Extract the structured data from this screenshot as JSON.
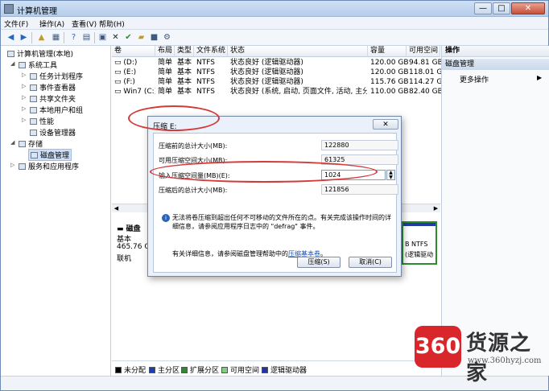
{
  "window": {
    "title": "计算机管理",
    "controls": {
      "minimize": "—",
      "maximize": "□",
      "close": "✕"
    }
  },
  "menu": [
    "文件(F)",
    "操作(A)",
    "查看(V)",
    "帮助(H)"
  ],
  "toolbar_icons": [
    "back-icon",
    "forward-icon",
    "up-icon",
    "console-icon",
    "help-icon",
    "view-icon",
    "properties-icon",
    "delete-icon",
    "check-icon",
    "open-icon",
    "save-icon",
    "settings-icon"
  ],
  "tree": {
    "root": "计算机管理(本地)",
    "system_tools": "系统工具",
    "task_scheduler": "任务计划程序",
    "event_viewer": "事件查看器",
    "shared_folders": "共享文件夹",
    "local_users": "本地用户和组",
    "performance": "性能",
    "device_manager": "设备管理器",
    "storage": "存储",
    "disk_management": "磁盘管理",
    "services": "服务和应用程序"
  },
  "volume_table": {
    "headers": [
      "卷",
      "布局",
      "类型",
      "文件系统",
      "状态",
      "容量",
      "可用空间"
    ],
    "rows": [
      [
        "(D:)",
        "简单",
        "基本",
        "NTFS",
        "状态良好 (逻辑驱动器)",
        "120.00 GB",
        "94.81 GB"
      ],
      [
        "(E:)",
        "简单",
        "基本",
        "NTFS",
        "状态良好 (逻辑驱动器)",
        "120.00 GB",
        "118.01 GB"
      ],
      [
        "(F:)",
        "简单",
        "基本",
        "NTFS",
        "状态良好 (逻辑驱动器)",
        "115.76 GB",
        "114.27 GB"
      ],
      [
        "Win7 (C:)",
        "简单",
        "基本",
        "NTFS",
        "状态良好 (系统, 启动, 页面文件, 活动, 主分区)",
        "110.00 GB",
        "82.40 GB"
      ]
    ]
  },
  "disk": {
    "name": "磁盘",
    "type": "基本",
    "size": "465.76 GB",
    "status": "联机",
    "right_fs": "B NTFS",
    "right_status": "(逻辑驱动"
  },
  "legend": [
    {
      "label": "未分配",
      "color": "#000000"
    },
    {
      "label": "主分区",
      "color": "#1d3fae"
    },
    {
      "label": "扩展分区",
      "color": "#2e8b2e"
    },
    {
      "label": "可用空间",
      "color": "#7fd17f"
    },
    {
      "label": "逻辑驱动器",
      "color": "#2233aa"
    }
  ],
  "actions": {
    "header": "操作",
    "section": "磁盘管理",
    "more": "更多操作"
  },
  "dialog": {
    "title": "压缩 E:",
    "close": "✕",
    "rows": [
      {
        "label": "压缩前的总计大小(MB):",
        "value": "122880"
      },
      {
        "label": "可用压缩空间大小(MB):",
        "value": "61325"
      },
      {
        "label": "输入压缩空间量(MB)(E):",
        "value": "1024"
      },
      {
        "label": "压缩后的总计大小(MB):",
        "value": "121856"
      }
    ],
    "note": "无法将卷压缩到超出任何不可移动的文件所在的点。有关完成该操作时间的详细信息，请参阅应用程序日志中的 \"defrag\" 事件。",
    "help_prefix": "有关详细信息，请参阅磁盘管理帮助中的",
    "help_link": "压缩基本卷",
    "help_suffix": "。",
    "ok": "压缩(S)",
    "cancel": "取消(C)"
  },
  "watermark": {
    "badge": "360",
    "text": "货源之家",
    "url": "www.360hyzj.com"
  },
  "colors": {
    "annotation_ellipse": "#d33a3a",
    "primary_partition": "#233ba5",
    "logical_drive_border": "#2e8b2e"
  }
}
